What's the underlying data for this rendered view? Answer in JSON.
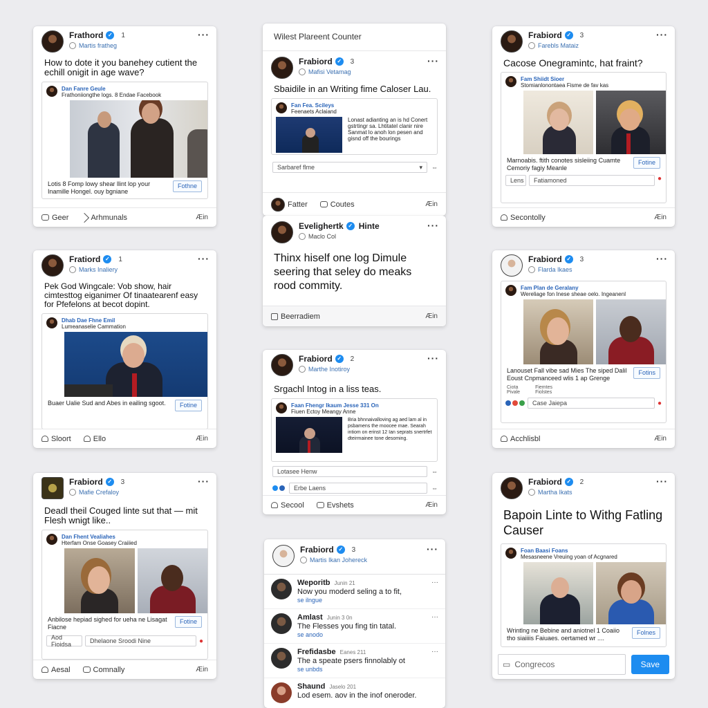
{
  "colors": {
    "accent": "#1d8cf0",
    "link": "#2a64b8",
    "background": "#ececef"
  },
  "cards": {
    "c1": {
      "name": "Frathord",
      "count": "1",
      "handle": "Martis fratheg",
      "headline": "How to dote it you banehey cutient the echill onigit in age wave?",
      "src_name": "Dan Fanre Geule",
      "src_sub": "Frathoniiongthe logs. 8 Endae Facebook",
      "caption": "Lotis 8 Fomp lowy shear llint lop your Inamille Hongel. ouy bgniane",
      "button": "Fothne",
      "footer_a": "Geer",
      "footer_b": "Arhmunals",
      "footer_right": "Æin"
    },
    "c2": {
      "section_title": "Wilest Plareent Counter",
      "name": "Frabiord",
      "count": "3",
      "handle": "Mafisi Vetamag",
      "headline": "Sbaidile in an Writing fime Caloser Lau.",
      "src_name": "Fan Fea. Scileys",
      "src_sub": "Feenaets Aclaiand",
      "article_text": "Lonast adianting an is hd Conert gstrtingr sa. Lhtitatel clanir nire Sanmat lo anoh lon pesen and gisnd off the bourings",
      "select_label": "Sarbaref flme",
      "footer_a": "Fatter",
      "footer_b": "Coutes",
      "footer_right": "Æin"
    },
    "c3": {
      "name": "Evelighertk",
      "badge": "Hinte",
      "handle": "Maclo Col",
      "headline": "Thinx hiself one log Dimule seering that seley do meaks rood commity.",
      "footer_a": "Beerradiem",
      "footer_right": "Æin"
    },
    "c4": {
      "name": "Frabiord",
      "count": "3",
      "handle": "Farebls Mataiz",
      "headline": "Cacose Onegramintc, hat fraint?",
      "src_name": "Fam Shiidt Sioer",
      "src_sub": "Stomianlonontaea Fisme de fav kas",
      "caption": "Marnoabis. ftith conotes sisleiing Cuamte Cemoriy fagiy Meanle",
      "button": "Fotine",
      "field_left": "Lens",
      "field_right": "Fatiamoned",
      "footer_a": "Secontolly",
      "footer_right": "Æin"
    },
    "c5": {
      "name": "Fratiord",
      "count": "1",
      "handle": "Marks Inaliery",
      "headline": "Pek God Wingcale: Vob show, hair cimtesttog eiganimer Of tinaatearenf easy for Pfefelons at becot dopint.",
      "src_name": "Dhab Dae Fhne Emil",
      "src_sub": "Lumeanaselie Cammation",
      "caption": "Buaer Ualie Sud and Abes in eailing sgoot.",
      "button": "Fotine",
      "footer_a": "Sloort",
      "footer_b": "Ello",
      "footer_right": "Æin"
    },
    "c6": {
      "name": "Frabiord",
      "count": "2",
      "handle": "Marthe Inotiroy",
      "headline": "Srgachl Intog in a liss teas.",
      "src_name": "Faan Fhengr Ikaum Jesse 331 On",
      "src_sub": "Fiuen Ectoy Meangy Anne",
      "article_text": "Bria bhnnaivalloving ag aed lam al in psbamens the moocee mae. Searah intiom on erinst 12 Ian seprats snertrfet dteirmainee tone desoming.",
      "field_a": "Lotasee Henw",
      "field_b": "Erbe Laens",
      "footer_a": "Secool",
      "footer_b": "Evshets",
      "footer_right": "Æin"
    },
    "c7": {
      "name": "Frabiord",
      "count": "3",
      "handle": "Flarda Ikaes",
      "src_name": "Fam Plan de Geralany",
      "src_sub": "Wereliage fon Inese sheae oelo. Ingeanenl",
      "caption": "Lanouset Fall vibe sad Mies The siped Dalil Eoust Cnpmanceed wlis 1 ap Grenge",
      "sub_a": "Ciota",
      "sub_b": "Pivale",
      "sub_c": "Fiemtes",
      "sub_d": "Fiolstes",
      "button": "Fotins",
      "field": "Case Jaiepa",
      "footer_a": "Acchlisbl",
      "footer_right": "Æin"
    },
    "c8": {
      "name": "Frabiord",
      "count": "3",
      "handle": "Mafie Crefaloy",
      "headline": "Deadl theil Couged linte sut that — mit Flesh wnigt like..",
      "src_name": "Dan Fhent Vealiahes",
      "src_sub": "Hterfam Onse Goasey Craiiied",
      "caption": "Anbilose hepiad sighed for ueha ne Lisagat Fiacne",
      "button": "Fotine",
      "field_left": "Aod Fioidsa",
      "field_right": "Dhelaone Sroodi Nine",
      "footer_a": "Aesal",
      "footer_b": "Comnally",
      "footer_right": "Æin"
    },
    "c9": {
      "name": "Frabiord",
      "count": "3",
      "handle": "Martis Ikan Johereck",
      "comments": [
        {
          "name": "Weporitb",
          "time": "Junin 21",
          "text": "Now you moderd seling a to fit,",
          "link": "se ilngue"
        },
        {
          "name": "Amlast",
          "time": "Junin 3 0n",
          "text": "The Flesses you fing tin tatal.",
          "link": "se anodo"
        },
        {
          "name": "Frefidasbe",
          "time": "Eanes 211",
          "text": "The a speate psers finnolably ot",
          "link": "se unbds"
        },
        {
          "name": "Shaund",
          "time": "Jaselo 201",
          "text": "Lod esem. aov in the inof oneroder.",
          "link": ""
        }
      ]
    },
    "c10": {
      "name": "Frabiord",
      "count": "2",
      "handle": "Martha Ikats",
      "headline": "Bapoin Linte to Withg Fatling Causer",
      "src_name": "Foan Baasi Foans",
      "src_sub": "Mesasneene Vreuing yoan of Acgnared",
      "caption": "Wrintlng ne Bebine and aniotnel 1 Coaiio tho siaiiiis Faiuaes. oertamed wr ....",
      "button": "Folnes",
      "input_placeholder": "Congrecos",
      "save": "Save"
    }
  }
}
